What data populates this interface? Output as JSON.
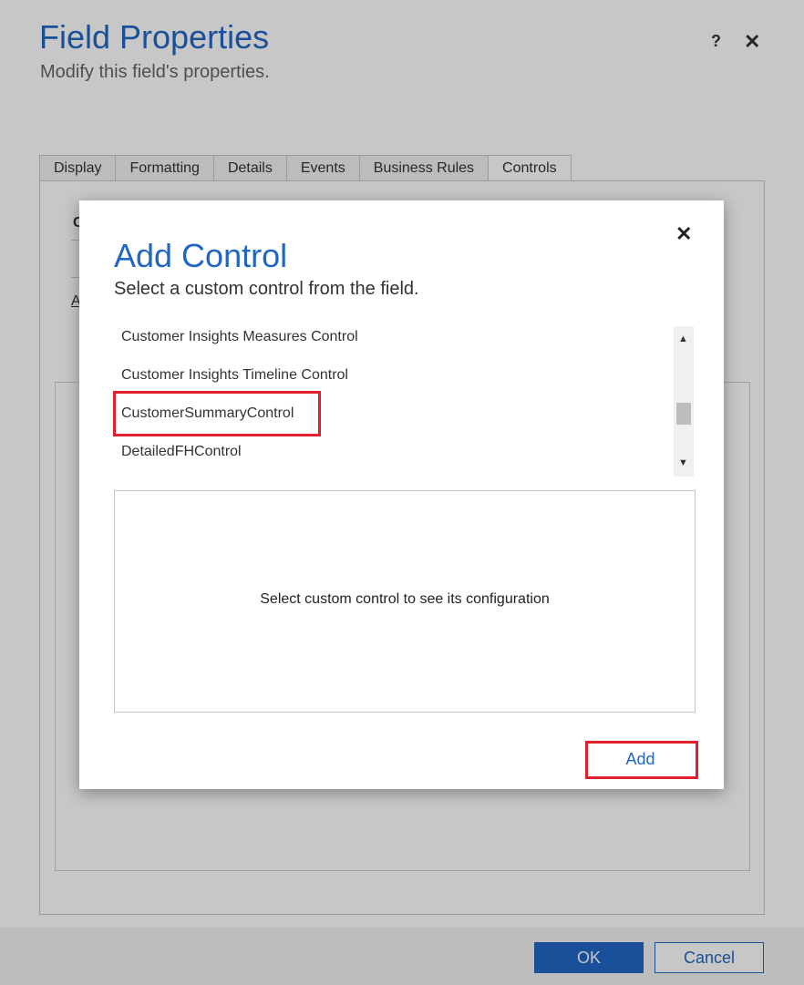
{
  "window": {
    "title": "Field Properties",
    "subtitle": "Modify this field's properties.",
    "help_glyph": "?",
    "close_glyph": "✕"
  },
  "tabs": [
    {
      "label": "Display"
    },
    {
      "label": "Formatting"
    },
    {
      "label": "Details"
    },
    {
      "label": "Events"
    },
    {
      "label": "Business Rules"
    },
    {
      "label": "Controls"
    }
  ],
  "footer": {
    "ok_label": "OK",
    "cancel_label": "Cancel"
  },
  "dialog": {
    "title": "Add Control",
    "subtitle": "Select a custom control from the field.",
    "close_glyph": "✕",
    "items": [
      {
        "label": "Customer Insights Measures Control"
      },
      {
        "label": "Customer Insights Timeline Control"
      },
      {
        "label": "CustomerSummaryControl"
      },
      {
        "label": "DetailedFHControl"
      }
    ],
    "config_message": "Select custom control to see its configuration",
    "add_label": "Add"
  },
  "colors": {
    "accent": "#2266c4",
    "highlight": "#e0202a"
  }
}
